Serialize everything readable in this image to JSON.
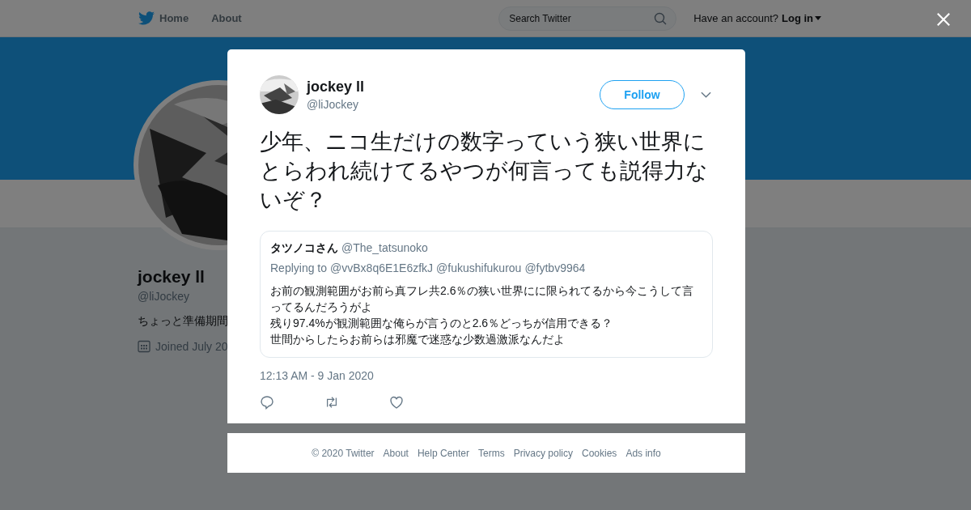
{
  "header": {
    "nav": [
      {
        "label": "Home",
        "kind": "home"
      },
      {
        "label": "About",
        "kind": "plain"
      }
    ],
    "search": {
      "placeholder": "Search Twitter"
    },
    "account_prompt": "Have an account?",
    "login": "Log in"
  },
  "profile": {
    "name": "jockey ll",
    "handle": "@liJockey",
    "bio": "ちょっと準備期間",
    "joined": "Joined July 20"
  },
  "tweet": {
    "name": "jockey ll",
    "handle": "@liJockey",
    "follow": "Follow",
    "text": "少年、ニコ生だけの数字っていう狭い世界にとらわれ続けてるやつが何言っても説得力ないぞ？",
    "quote": {
      "name": "タツノコさん",
      "handle": "@The_tatsunoko",
      "replying_label": "Replying to",
      "replying_to": [
        "@vvBx8q6E1E6zfkJ",
        "@fukushifukurou",
        "@fytbv9964"
      ],
      "lines": [
        "お前の観測範囲がお前ら真フレ共2.6％の狭い世界にに限られてるから今こうして言ってるんだろうがよ",
        "残り97.4%が観測範囲な俺らが言うのと2.6％どっちが信用できる？",
        "世間からしたらお前らは邪魔で迷惑な少数過激派なんだよ"
      ]
    },
    "time": "12:13 AM - 9 Jan 2020"
  },
  "footer": [
    "© 2020 Twitter",
    "About",
    "Help Center",
    "Terms",
    "Privacy policy",
    "Cookies",
    "Ads info"
  ]
}
